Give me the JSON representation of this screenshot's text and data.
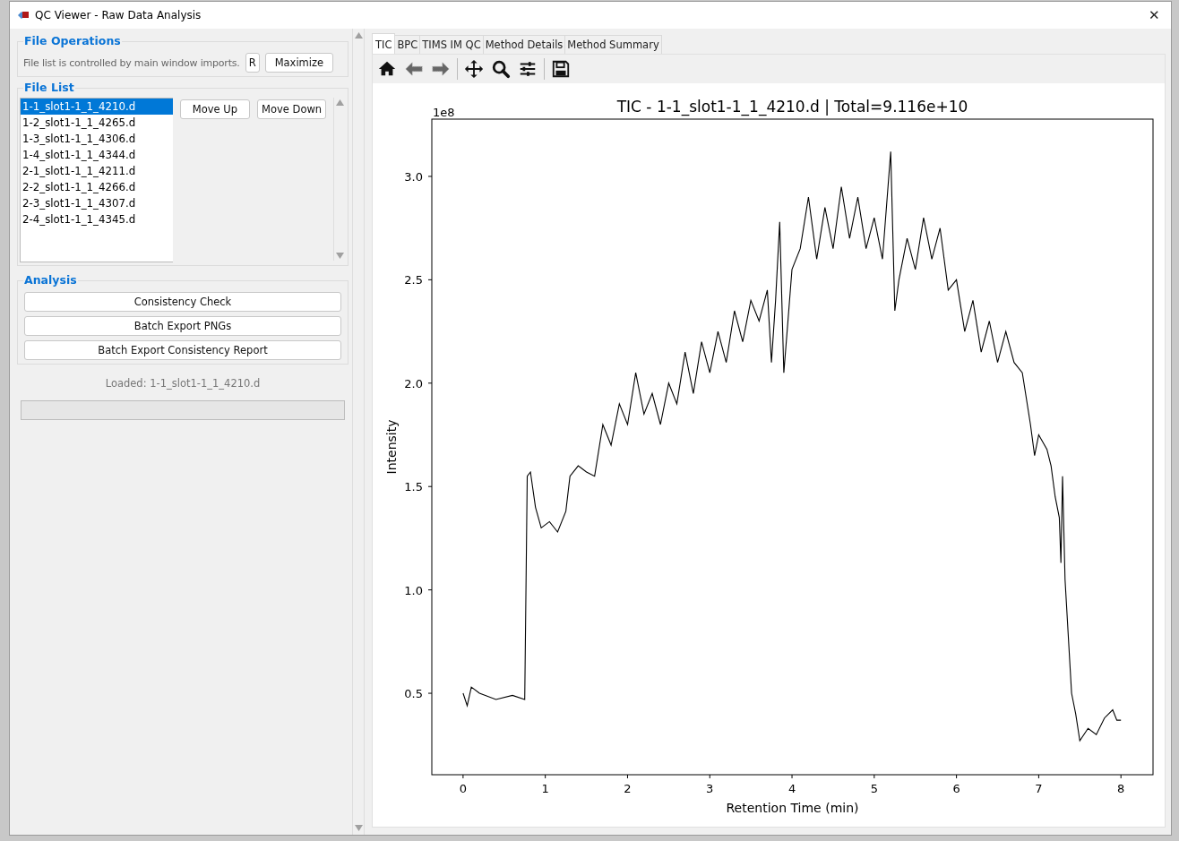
{
  "window": {
    "title": "QC Viewer - Raw Data Analysis",
    "close": "✕"
  },
  "file_operations": {
    "title": "File Operations",
    "note": "File list is controlled by main window imports.",
    "buttons": [
      "R",
      "Maximize"
    ]
  },
  "file_list": {
    "title": "File List",
    "items": [
      {
        "label": "1-1_slot1-1_1_4210.d",
        "selected": true
      },
      {
        "label": "1-2_slot1-1_1_4265.d",
        "selected": false
      },
      {
        "label": "1-3_slot1-1_1_4306.d",
        "selected": false
      },
      {
        "label": "1-4_slot1-1_1_4344.d",
        "selected": false
      },
      {
        "label": "2-1_slot1-1_1_4211.d",
        "selected": false
      },
      {
        "label": "2-2_slot1-1_1_4266.d",
        "selected": false
      },
      {
        "label": "2-3_slot1-1_1_4307.d",
        "selected": false
      },
      {
        "label": "2-4_slot1-1_1_4345.d",
        "selected": false
      }
    ],
    "buttons": [
      "Move Up",
      "Move Down"
    ]
  },
  "analysis": {
    "title": "Analysis",
    "buttons": [
      "Consistency Check",
      "Batch Export PNGs",
      "Batch Export Consistency Report"
    ]
  },
  "status": "Loaded: 1-1_slot1-1_1_4210.d",
  "progress": {
    "level": 0
  },
  "tabs": [
    {
      "label": "TIC",
      "selected": true
    },
    {
      "label": "BPC",
      "selected": false
    },
    {
      "label": "TIMS IM QC",
      "selected": false
    },
    {
      "label": "Method Details",
      "selected": false
    },
    {
      "label": "Method Summary",
      "selected": false
    }
  ],
  "plot": {
    "axis_multiplier": "1e8",
    "chart_data": {
      "type": "line",
      "title": "TIC - 1-1_slot1-1_1_4210.d | Total=9.116e+10",
      "xlabel": "Retention Time (min)",
      "ylabel": "Intensity",
      "xlim": [
        -0.38,
        8.39
      ],
      "ylim": [
        0.106,
        3.277
      ],
      "xticks": [
        0,
        1,
        2,
        3,
        4,
        5,
        6,
        7,
        8
      ],
      "yticks": [
        0.5,
        {
          "value": 1,
          "label": "1.0"
        },
        1.5,
        {
          "value": 2,
          "label": "2.0"
        },
        2.5,
        {
          "value": 3,
          "label": "3.0"
        }
      ],
      "x": [
        0,
        0.05,
        0.1,
        0.2,
        0.4,
        0.6,
        0.75,
        0.78,
        0.82,
        0.88,
        0.95,
        1.05,
        1.15,
        1.25,
        1.3,
        1.4,
        1.5,
        1.6,
        1.7,
        1.8,
        1.9,
        2.0,
        2.1,
        2.2,
        2.3,
        2.4,
        2.5,
        2.6,
        2.7,
        2.8,
        2.9,
        3.0,
        3.1,
        3.2,
        3.3,
        3.4,
        3.5,
        3.6,
        3.7,
        3.75,
        3.8,
        3.85,
        3.9,
        3.95,
        4.0,
        4.1,
        4.2,
        4.3,
        4.4,
        4.5,
        4.6,
        4.7,
        4.8,
        4.9,
        5.0,
        5.1,
        5.2,
        5.25,
        5.3,
        5.4,
        5.5,
        5.6,
        5.7,
        5.8,
        5.9,
        6.0,
        6.1,
        6.2,
        6.3,
        6.4,
        6.5,
        6.6,
        6.7,
        6.8,
        6.9,
        6.95,
        7.0,
        7.1,
        7.15,
        7.2,
        7.25,
        7.27,
        7.29,
        7.32,
        7.4,
        7.45,
        7.5,
        7.6,
        7.7,
        7.8,
        7.9,
        7.95,
        8.0
      ],
      "series": [
        {
          "color": "#000000",
          "values": [
            0.5,
            0.44,
            0.53,
            0.5,
            0.47,
            0.49,
            0.47,
            1.55,
            1.57,
            1.4,
            1.3,
            1.33,
            1.28,
            1.38,
            1.55,
            1.6,
            1.57,
            1.55,
            1.8,
            1.7,
            1.9,
            1.8,
            2.05,
            1.85,
            1.95,
            1.8,
            2.0,
            1.9,
            2.15,
            1.95,
            2.2,
            2.05,
            2.25,
            2.1,
            2.35,
            2.2,
            2.4,
            2.3,
            2.45,
            2.1,
            2.4,
            2.78,
            2.05,
            2.3,
            2.55,
            2.65,
            2.9,
            2.6,
            2.85,
            2.65,
            2.95,
            2.7,
            2.9,
            2.65,
            2.8,
            2.6,
            3.12,
            2.35,
            2.5,
            2.7,
            2.55,
            2.8,
            2.6,
            2.75,
            2.45,
            2.5,
            2.25,
            2.4,
            2.15,
            2.3,
            2.1,
            2.25,
            2.1,
            2.05,
            1.8,
            1.65,
            1.75,
            1.68,
            1.6,
            1.45,
            1.35,
            1.13,
            1.55,
            1.05,
            0.5,
            0.4,
            0.27,
            0.33,
            0.3,
            0.38,
            0.42,
            0.37,
            0.37
          ]
        }
      ]
    }
  }
}
